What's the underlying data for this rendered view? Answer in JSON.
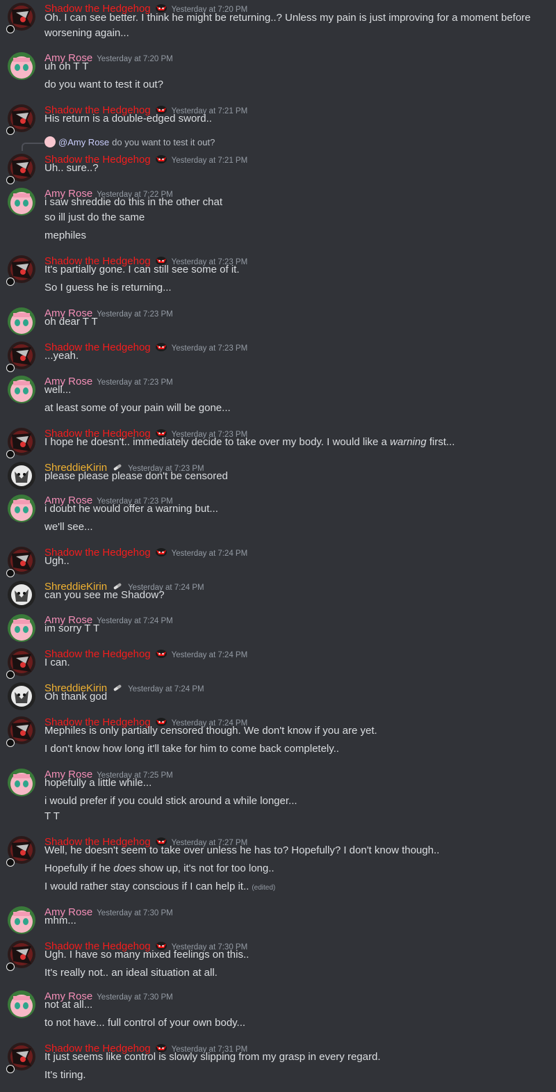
{
  "colors": {
    "shadow": "#f21d1d",
    "amy": "#f58fb8",
    "shreddie": "#f0b232",
    "background": "#313338",
    "text": "#dbdee1",
    "timestamp": "#949ba4"
  },
  "users": {
    "shadow": "Shadow the Hedgehog",
    "amy": "Amy Rose",
    "shreddie": "ShreddieKirin"
  },
  "reply": {
    "mention": "@Amy Rose",
    "text": "do you want to test it out?"
  },
  "messages": [
    {
      "user": "shadow",
      "time": "Yesterday at 7:20 PM",
      "lines": [
        "Oh. I can see better. I think he might be returning..? Unless my pain is just improving for a moment before",
        "worsening again..."
      ]
    },
    {
      "user": "amy",
      "time": "Yesterday at 7:20 PM",
      "lines": [
        "uh oh T T",
        "do you want to test it out?"
      ]
    },
    {
      "user": "shadow",
      "time": "Yesterday at 7:21 PM",
      "lines": [
        "His return is a double-edged sword.."
      ]
    },
    {
      "user": "shadow",
      "time": "Yesterday at 7:21 PM",
      "lines": [
        "Uh.. sure..?"
      ]
    },
    {
      "user": "amy",
      "time": "Yesterday at 7:22 PM",
      "lines": [
        "i saw shreddie do this in the other chat",
        "so ill just do the same",
        "mephiles"
      ]
    },
    {
      "user": "shadow",
      "time": "Yesterday at 7:23 PM",
      "lines": [
        "It's partially gone. I can still see some of it.",
        "So I guess he is returning..."
      ]
    },
    {
      "user": "amy",
      "time": "Yesterday at 7:23 PM",
      "lines": [
        "oh dear T T"
      ]
    },
    {
      "user": "shadow",
      "time": "Yesterday at 7:23 PM",
      "lines": [
        "...yeah."
      ]
    },
    {
      "user": "amy",
      "time": "Yesterday at 7:23 PM",
      "lines": [
        "well...",
        "at least some of your pain will be gone..."
      ]
    },
    {
      "user": "shadow",
      "time": "Yesterday at 7:23 PM",
      "lines": [
        "I hope he doesn't.. immediately decide to take over my body. I would like a ",
        "warning",
        " first..."
      ]
    },
    {
      "user": "shreddie",
      "time": "Yesterday at 7:23 PM",
      "lines": [
        "please please please don't be censored"
      ]
    },
    {
      "user": "amy",
      "time": "Yesterday at 7:23 PM",
      "lines": [
        "i doubt he would offer a warning but...",
        "we'll see..."
      ]
    },
    {
      "user": "shadow",
      "time": "Yesterday at 7:24 PM",
      "lines": [
        "Ugh.."
      ]
    },
    {
      "user": "shreddie",
      "time": "Yesterday at 7:24 PM",
      "lines": [
        "can you see me Shadow?"
      ]
    },
    {
      "user": "amy",
      "time": "Yesterday at 7:24 PM",
      "lines": [
        "im sorry T T"
      ]
    },
    {
      "user": "shadow",
      "time": "Yesterday at 7:24 PM",
      "lines": [
        "I can."
      ]
    },
    {
      "user": "shreddie",
      "time": "Yesterday at 7:24 PM",
      "lines": [
        "Oh thank god"
      ]
    },
    {
      "user": "shadow",
      "time": "Yesterday at 7:24 PM",
      "lines": [
        "Mephiles is only partially censored though. We don't know if you are yet.",
        "I don't know how long it'll take for him to come back completely.."
      ]
    },
    {
      "user": "amy",
      "time": "Yesterday at 7:25 PM",
      "lines": [
        "hopefully a little while...",
        "i would prefer if you could stick around a while longer...",
        "T T"
      ]
    },
    {
      "user": "shadow",
      "time": "Yesterday at 7:27 PM",
      "lines": [
        "Well, he doesn't seem to take over unless he has to? Hopefully? I don't know though..",
        "Hopefully if he ",
        "does",
        " show up, it's not for too long..",
        "I would rather stay conscious if I can help it..",
        "(edited)"
      ]
    },
    {
      "user": "amy",
      "time": "Yesterday at 7:30 PM",
      "lines": [
        "mhm..."
      ]
    },
    {
      "user": "shadow",
      "time": "Yesterday at 7:30 PM",
      "lines": [
        "Ugh. I have so many mixed feelings on this..",
        "It's really not.. an ideal situation at all."
      ]
    },
    {
      "user": "amy",
      "time": "Yesterday at 7:30 PM",
      "lines": [
        "not at all...",
        "to not have... full control of your own body..."
      ]
    },
    {
      "user": "shadow",
      "time": "Yesterday at 7:31 PM",
      "lines": [
        "It just seems like control is slowly slipping from my grasp in every regard.",
        "It's tiring."
      ]
    }
  ]
}
